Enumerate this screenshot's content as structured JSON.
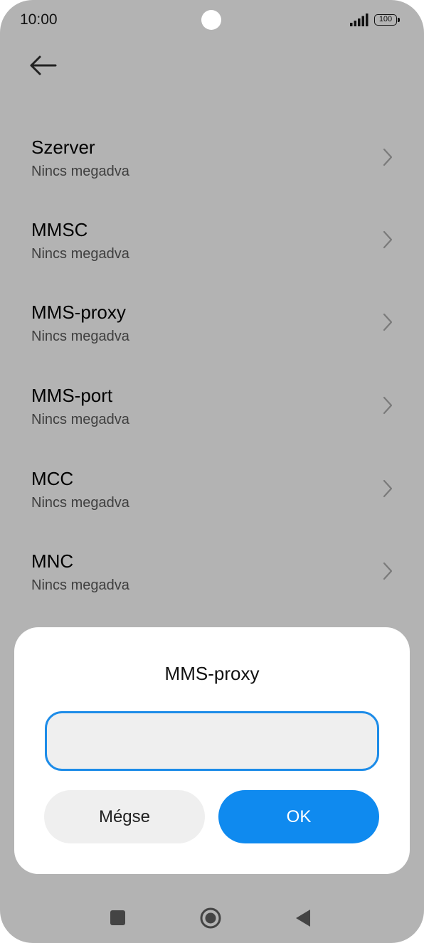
{
  "status_bar": {
    "time": "10:00",
    "battery_level": "100",
    "icons": [
      "signal-icon",
      "battery-icon",
      "camera-cutout"
    ]
  },
  "header": {
    "back_icon": "arrow-left-icon"
  },
  "list": {
    "items": [
      {
        "title": "Szerver",
        "subtitle": "Nincs megadva"
      },
      {
        "title": "MMSC",
        "subtitle": "Nincs megadva"
      },
      {
        "title": "MMS-proxy",
        "subtitle": "Nincs megadva"
      },
      {
        "title": "MMS-port",
        "subtitle": "Nincs megadva"
      },
      {
        "title": "MCC",
        "subtitle": "Nincs megadva"
      },
      {
        "title": "MNC",
        "subtitle": "Nincs megadva"
      }
    ],
    "chevron_icon": "chevron-right-icon"
  },
  "dialog": {
    "title": "MMS-proxy",
    "input_value": "",
    "cancel_label": "Mégse",
    "ok_label": "OK"
  },
  "nav_bar": {
    "icons": [
      "recents-icon",
      "home-icon",
      "back-triangle-icon"
    ]
  },
  "colors": {
    "scrim": "#b3b3b3",
    "accent": "#0f8aef",
    "input_border": "#1d8ce8",
    "input_fill": "#efefef"
  }
}
